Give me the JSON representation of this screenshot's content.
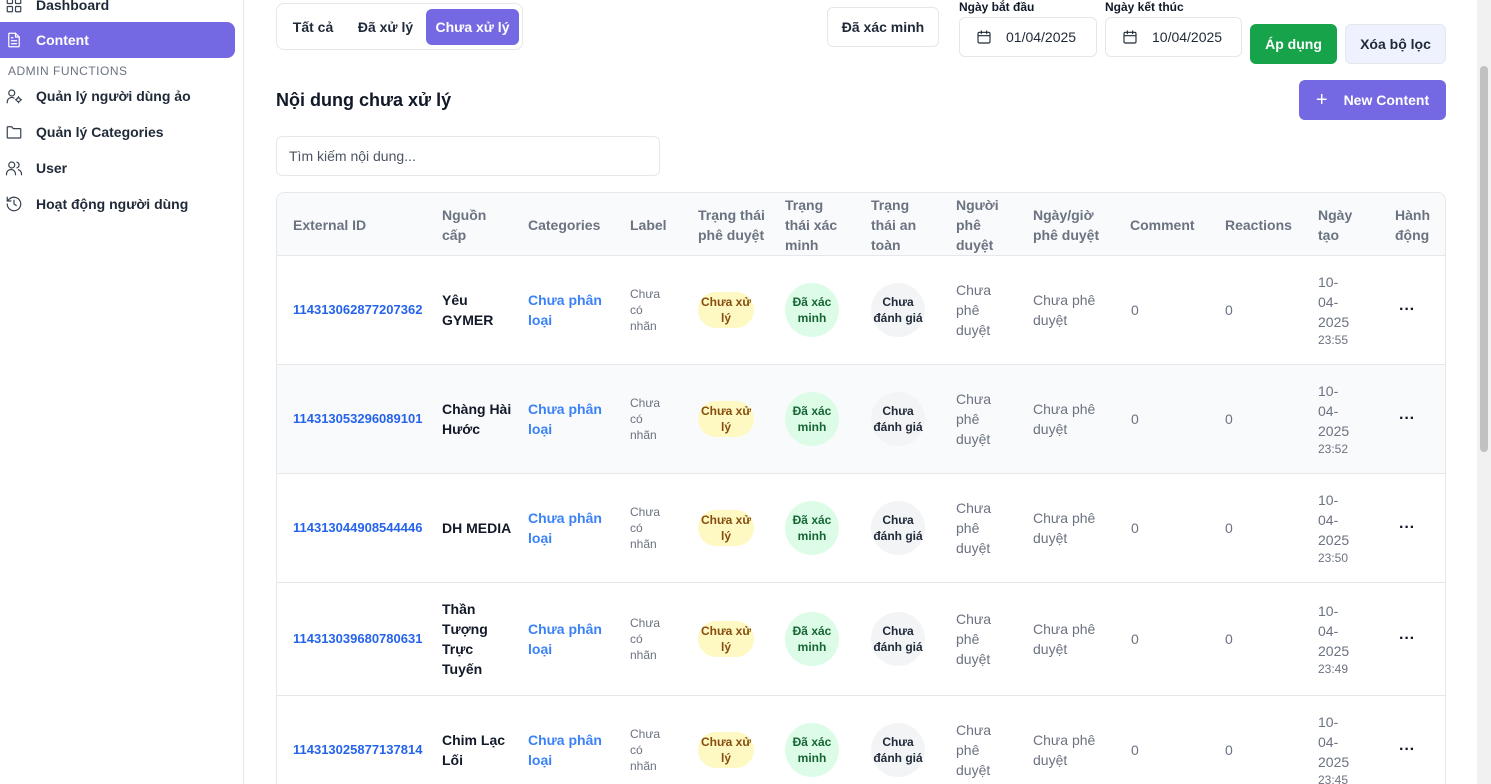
{
  "sidebar": {
    "items_top": [
      {
        "label": "Dashboard",
        "icon": "dashboard-icon"
      },
      {
        "label": "Content",
        "icon": "document-icon",
        "active": true
      }
    ],
    "section_label": "ADMIN FUNCTIONS",
    "items_admin": [
      {
        "label": "Quản lý người dùng ảo",
        "icon": "user-cog-icon"
      },
      {
        "label": "Quản lý Categories",
        "icon": "folder-icon"
      },
      {
        "label": "User",
        "icon": "users-icon"
      },
      {
        "label": "Hoạt động người dùng",
        "icon": "history-icon"
      }
    ]
  },
  "filters": {
    "tabs": [
      "Tất cả",
      "Đã xử lý",
      "Chưa xử lý"
    ],
    "active_tab": "Chưa xử lý",
    "verified_button": "Đã xác minh",
    "start_date_label": "Ngày bắt đầu",
    "start_date": "01/04/2025",
    "end_date_label": "Ngày kết thúc",
    "end_date": "10/04/2025",
    "apply_button": "Áp dụng",
    "clear_button": "Xóa bộ lọc"
  },
  "main": {
    "title": "Nội dung chưa xử lý",
    "new_button": "New Content",
    "search_placeholder": "Tìm kiếm nội dung..."
  },
  "table": {
    "columns": [
      "External ID",
      "Nguồn cấp",
      "Categories",
      "Label",
      "Trạng thái phê duyệt",
      "Trạng thái xác minh",
      "Trạng thái an toàn",
      "Người phê duyệt",
      "Ngày/giờ phê duyệt",
      "Comment",
      "Reactions",
      "Ngày tạo",
      "Hành động"
    ],
    "rows": [
      {
        "external_id": "114313062877207362",
        "source": "Yêu GYMER",
        "category": "Chưa phân loại",
        "label": "Chưa có nhãn",
        "approval": "Chưa xử lý",
        "verification": "Đã xác minh",
        "safety": "Chưa đánh giá",
        "approver": "Chưa phê duyệt",
        "approved_at": "Chưa phê duyệt",
        "comments": "0",
        "reactions": "0",
        "created_date": "10-04-2025",
        "created_time": "23:55",
        "action": "···"
      },
      {
        "external_id": "114313053296089101",
        "source": "Chàng Hài Hước",
        "category": "Chưa phân loại",
        "label": "Chưa có nhãn",
        "approval": "Chưa xử lý",
        "verification": "Đã xác minh",
        "safety": "Chưa đánh giá",
        "approver": "Chưa phê duyệt",
        "approved_at": "Chưa phê duyệt",
        "comments": "0",
        "reactions": "0",
        "created_date": "10-04-2025",
        "created_time": "23:52",
        "action": "···"
      },
      {
        "external_id": "114313044908544446",
        "source": "DH MEDIA",
        "category": "Chưa phân loại",
        "label": "Chưa có nhãn",
        "approval": "Chưa xử lý",
        "verification": "Đã xác minh",
        "safety": "Chưa đánh giá",
        "approver": "Chưa phê duyệt",
        "approved_at": "Chưa phê duyệt",
        "comments": "0",
        "reactions": "0",
        "created_date": "10-04-2025",
        "created_time": "23:50",
        "action": "···"
      },
      {
        "external_id": "114313039680780631",
        "source": "Thần Tượng Trực Tuyến",
        "category": "Chưa phân loại",
        "label": "Chưa có nhãn",
        "approval": "Chưa xử lý",
        "verification": "Đã xác minh",
        "safety": "Chưa đánh giá",
        "approver": "Chưa phê duyệt",
        "approved_at": "Chưa phê duyệt",
        "comments": "0",
        "reactions": "0",
        "created_date": "10-04-2025",
        "created_time": "23:49",
        "action": "···"
      },
      {
        "external_id": "114313025877137814",
        "source": "Chim Lạc Lối",
        "category": "Chưa phân loại",
        "label": "Chưa có nhãn",
        "approval": "Chưa xử lý",
        "verification": "Đã xác minh",
        "safety": "Chưa đánh giá",
        "approver": "Chưa phê duyệt",
        "approved_at": "Chưa phê duyệt",
        "comments": "0",
        "reactions": "0",
        "created_date": "10-04-2025",
        "created_time": "23:45",
        "action": "···"
      }
    ]
  }
}
